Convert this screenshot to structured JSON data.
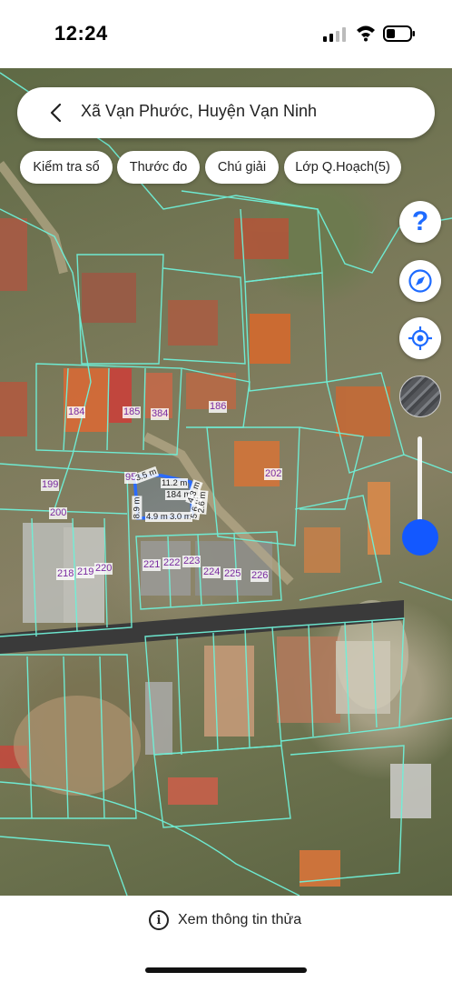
{
  "status_bar": {
    "time": "12:24"
  },
  "header": {
    "title": "Xã Vạn Phước, Huyện Vạn Ninh"
  },
  "chips": [
    "Kiểm tra sổ",
    "Thước đo",
    "Chú giải",
    "Lớp Q.Hoạch(5)"
  ],
  "controls": {
    "help_glyph": "?",
    "accent_color": "#1358ff",
    "zoom_level": 0.15
  },
  "parcels": [
    "184",
    "185",
    "384",
    "186",
    "202",
    "199",
    "200",
    "95",
    "218",
    "219",
    "220",
    "221",
    "222",
    "223",
    "224",
    "225",
    "226"
  ],
  "selected_parcel": {
    "area": "184 m²",
    "dimensions": [
      "11.2 m",
      "8.9 m",
      "4.9 m",
      "3.0 m",
      "5.6 m",
      "4.3 m",
      "3.5 m",
      "2.6 m"
    ]
  },
  "footer": {
    "info_label": "Xem thông tin thửa"
  },
  "icons": [
    "back-chevron-icon",
    "help-icon",
    "compass-icon",
    "locate-icon",
    "layer-icon",
    "info-icon"
  ]
}
